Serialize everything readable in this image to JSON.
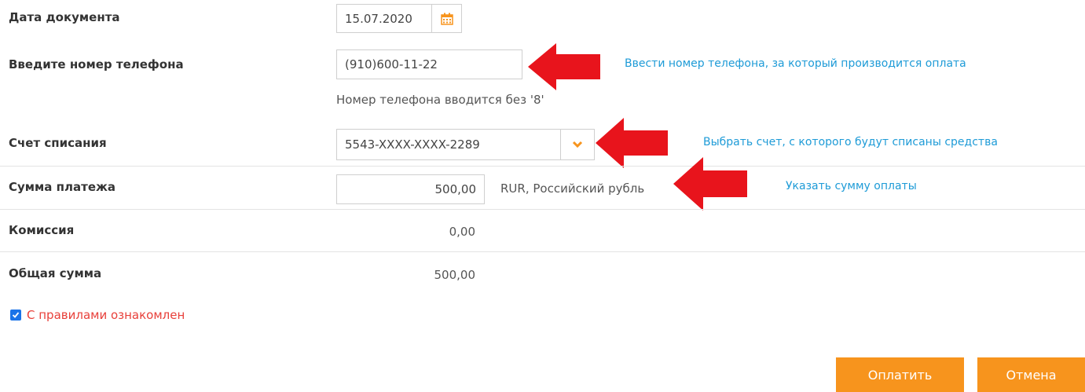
{
  "form": {
    "doc_date": {
      "label": "Дата документа",
      "value": "15.07.2020"
    },
    "phone": {
      "label": "Введите номер телефона",
      "value": "(910)600-11-22",
      "note": "Номер телефона вводится без '8'",
      "hint": "Ввести номер телефона, за который производится оплата"
    },
    "account": {
      "label": "Счет списания",
      "value": "5543-XXXX-XXXX-2289",
      "hint": "Выбрать счет, с которого будут списаны средства"
    },
    "amount": {
      "label": "Сумма платежа",
      "value": "500,00",
      "currency": "RUR, Российский рубль",
      "hint": "Указать сумму оплаты"
    },
    "commission": {
      "label": "Комиссия",
      "value": "0,00"
    },
    "total": {
      "label": "Общая сумма",
      "value": "500,00"
    },
    "rules": {
      "label": "С правилами ознакомлен",
      "checked": true
    }
  },
  "buttons": {
    "pay": "Оплатить",
    "cancel": "Отмена"
  },
  "icons": {
    "date_picker": "calendar-icon",
    "dropdown": "chevron-down-icon",
    "annotation": "red-arrow-icon"
  },
  "colors": {
    "accent": "#f7941d",
    "hint": "#1e9bd7",
    "rules": "#e8403a",
    "arrow": "#e8141c"
  }
}
